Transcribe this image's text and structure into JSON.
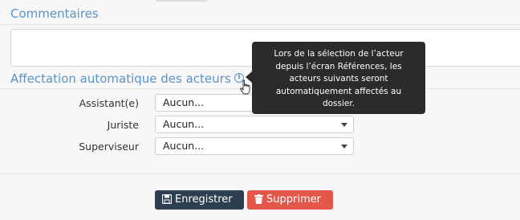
{
  "comments": {
    "title": "Commentaires",
    "value": ""
  },
  "affectation": {
    "title": "Affectation automatique des acteurs",
    "info_icon": "info-icon",
    "tooltip": "Lors de la sélection de l’acteur depuis l’écran Références, les acteurs suivants seront automatiquement affectés au dossier.",
    "rows": [
      {
        "label": "Assistant(e)",
        "value": "Aucun..."
      },
      {
        "label": "Juriste",
        "value": "Aucun..."
      },
      {
        "label": "Superviseur",
        "value": "Aucun..."
      }
    ]
  },
  "buttons": {
    "save": {
      "label": "Enregistrer",
      "icon": "save-icon",
      "color": "#2c3e50"
    },
    "delete": {
      "label": "Supprimer",
      "icon": "trash-icon",
      "color": "#e4554a"
    }
  },
  "colors": {
    "accent": "#5b93c7",
    "tooltip_bg": "#2b2b2b"
  }
}
